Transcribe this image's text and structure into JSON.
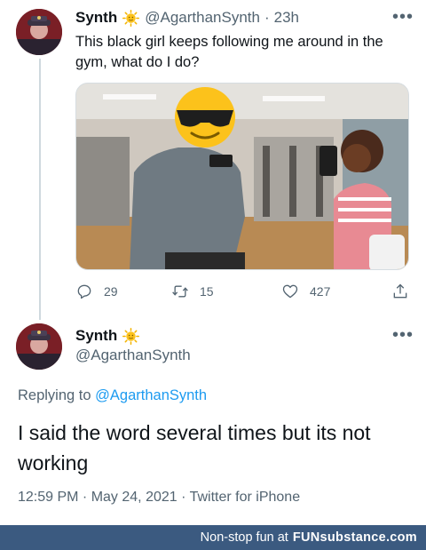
{
  "tweet1": {
    "name": "Synth",
    "handle": "@AgarthanSynth",
    "separator": "·",
    "time": "23h",
    "more": "•••",
    "text": "This black girl keeps following me around in the gym, what do I do?",
    "replies": "29",
    "retweets": "15",
    "likes": "427"
  },
  "tweet2": {
    "name": "Synth",
    "handle": "@AgarthanSynth",
    "more": "•••",
    "replying_prefix": "Replying to",
    "replying_to": "@AgarthanSynth",
    "text": "I said the word several times but its not working",
    "timestamp": "12:59 PM · May 24, 2021 · Twitter for iPhone"
  },
  "footer": {
    "prefix": "Non-stop fun at",
    "brand": "FUNsubstance.com"
  },
  "icons": {
    "verified": "sun-emoji-icon",
    "reply": "reply-icon",
    "retweet": "retweet-icon",
    "like": "heart-icon",
    "share": "share-icon",
    "face": "sunglasses-emoji-icon"
  },
  "colors": {
    "link": "#1d9bf0",
    "secondary_text": "#536471",
    "footer_bg": "#3b5a80"
  }
}
